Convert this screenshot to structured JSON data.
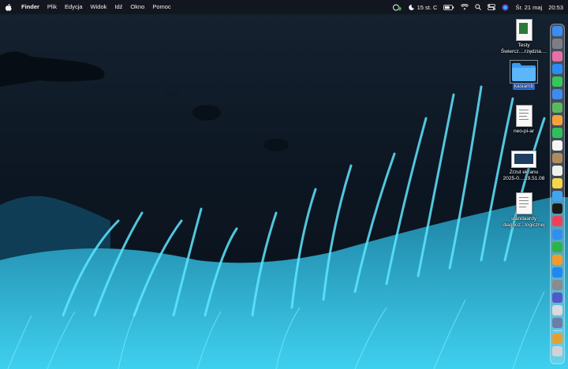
{
  "menubar": {
    "app_name": "Finder",
    "menus": [
      "Plik",
      "Edycja",
      "Widok",
      "Idź",
      "Okno",
      "Pomoc"
    ],
    "weather": "15 st. C",
    "date": "Śr. 21 maj",
    "time": "20:53"
  },
  "desktop": {
    "icons": [
      {
        "label_line1": "Testy",
        "label_line2": "Świercz....rzędzia....",
        "icon": "document-icon"
      },
      {
        "label_line1": "kasiamb",
        "icon": "folder-icon",
        "selected": true
      },
      {
        "label_line1": "neo-pi-ar",
        "icon": "document-icon"
      },
      {
        "label_line1": "Zrzut ekranu",
        "label_line2": "2025-0....19.51.08",
        "icon": "screenshot-icon"
      },
      {
        "label_line1": "standaardy",
        "label_line2": "diagnoz...logicznej",
        "icon": "document-icon"
      }
    ]
  },
  "dock": {
    "apps": [
      {
        "name": "finder-icon",
        "color": "#3b8df0"
      },
      {
        "name": "launchpad-icon",
        "color": "#7d7d85"
      },
      {
        "name": "apps-grid-icon",
        "color": "#e86ea7"
      },
      {
        "name": "safari-icon",
        "color": "#2a8cf5"
      },
      {
        "name": "messages-icon",
        "color": "#34c759"
      },
      {
        "name": "mail-icon",
        "color": "#3d8bf2"
      },
      {
        "name": "maps-icon",
        "color": "#5cb85c"
      },
      {
        "name": "photos-icon",
        "color": "#f4a13a"
      },
      {
        "name": "facetime-icon",
        "color": "#30c05a"
      },
      {
        "name": "calendar-icon",
        "color": "#f5f5f5"
      },
      {
        "name": "contacts-icon",
        "color": "#b08b5e"
      },
      {
        "name": "reminders-icon",
        "color": "#f0f0f0"
      },
      {
        "name": "notes-icon",
        "color": "#f7d64a"
      },
      {
        "name": "freeform-icon",
        "color": "#3fa5f0"
      },
      {
        "name": "apple-tv-icon",
        "color": "#1a1a1a"
      },
      {
        "name": "music-icon",
        "color": "#f23f55"
      },
      {
        "name": "keynote-icon",
        "color": "#2f8ff0"
      },
      {
        "name": "numbers-icon",
        "color": "#2fb24a"
      },
      {
        "name": "pages-icon",
        "color": "#f49a2a"
      },
      {
        "name": "app-store-icon",
        "color": "#1e88f2"
      },
      {
        "name": "settings-icon",
        "color": "#8a8a90"
      },
      {
        "name": "teams-icon",
        "color": "#5059c9"
      },
      {
        "name": "script-editor-icon",
        "color": "#d9d9de"
      },
      {
        "name": "preview-icon",
        "color": "#6a7ea8"
      },
      {
        "name": "archive-icon",
        "color": "#e6a030"
      },
      {
        "name": "trash-icon",
        "color": "#cfd3d8"
      }
    ]
  }
}
